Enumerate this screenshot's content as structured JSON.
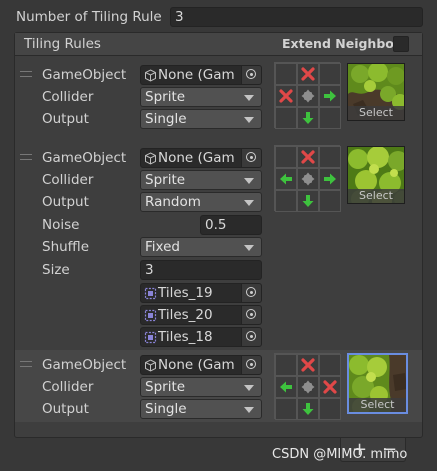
{
  "header": {
    "count_label": "Number of Tiling Rule",
    "count_value": "3"
  },
  "panel": {
    "title": "Tiling Rules",
    "extend_neighbor_label": "Extend Neighbor",
    "extend_neighbor_checked": false
  },
  "field_labels": {
    "gameobject": "GameObject",
    "collider": "Collider",
    "output": "Output",
    "noise": "Noise",
    "shuffle": "Shuffle",
    "size": "Size"
  },
  "rules": [
    {
      "gameobject": "None (Gam",
      "collider": "Sprite",
      "output": "Single",
      "neighbors": [
        "empty",
        "x",
        "empty",
        "x",
        "center",
        "arrow-right",
        "empty",
        "arrow-down",
        "empty"
      ],
      "select_label": "Select",
      "selected": false
    },
    {
      "gameobject": "None (Gam",
      "collider": "Sprite",
      "output": "Random",
      "noise": "0.5",
      "shuffle": "Fixed",
      "size": "3",
      "sprites": [
        "Tiles_19",
        "Tiles_20",
        "Tiles_18"
      ],
      "neighbors": [
        "empty",
        "x",
        "empty",
        "arrow-left",
        "center",
        "arrow-right",
        "empty",
        "arrow-down",
        "empty"
      ],
      "select_label": "Select",
      "selected": false
    },
    {
      "gameobject": "None (Gam",
      "collider": "Sprite",
      "output": "Single",
      "neighbors": [
        "empty",
        "x",
        "empty",
        "arrow-left",
        "center",
        "x",
        "empty",
        "arrow-down",
        "empty"
      ],
      "select_label": "Select",
      "selected": true
    }
  ],
  "footer": {
    "add_label": "+",
    "remove_label": "−"
  },
  "watermark": "CSDN @MIMO. mimo",
  "colors": {
    "x_red": "#e04848",
    "arrow_green": "#3ec23e",
    "selection_blue": "#6a8de0"
  }
}
